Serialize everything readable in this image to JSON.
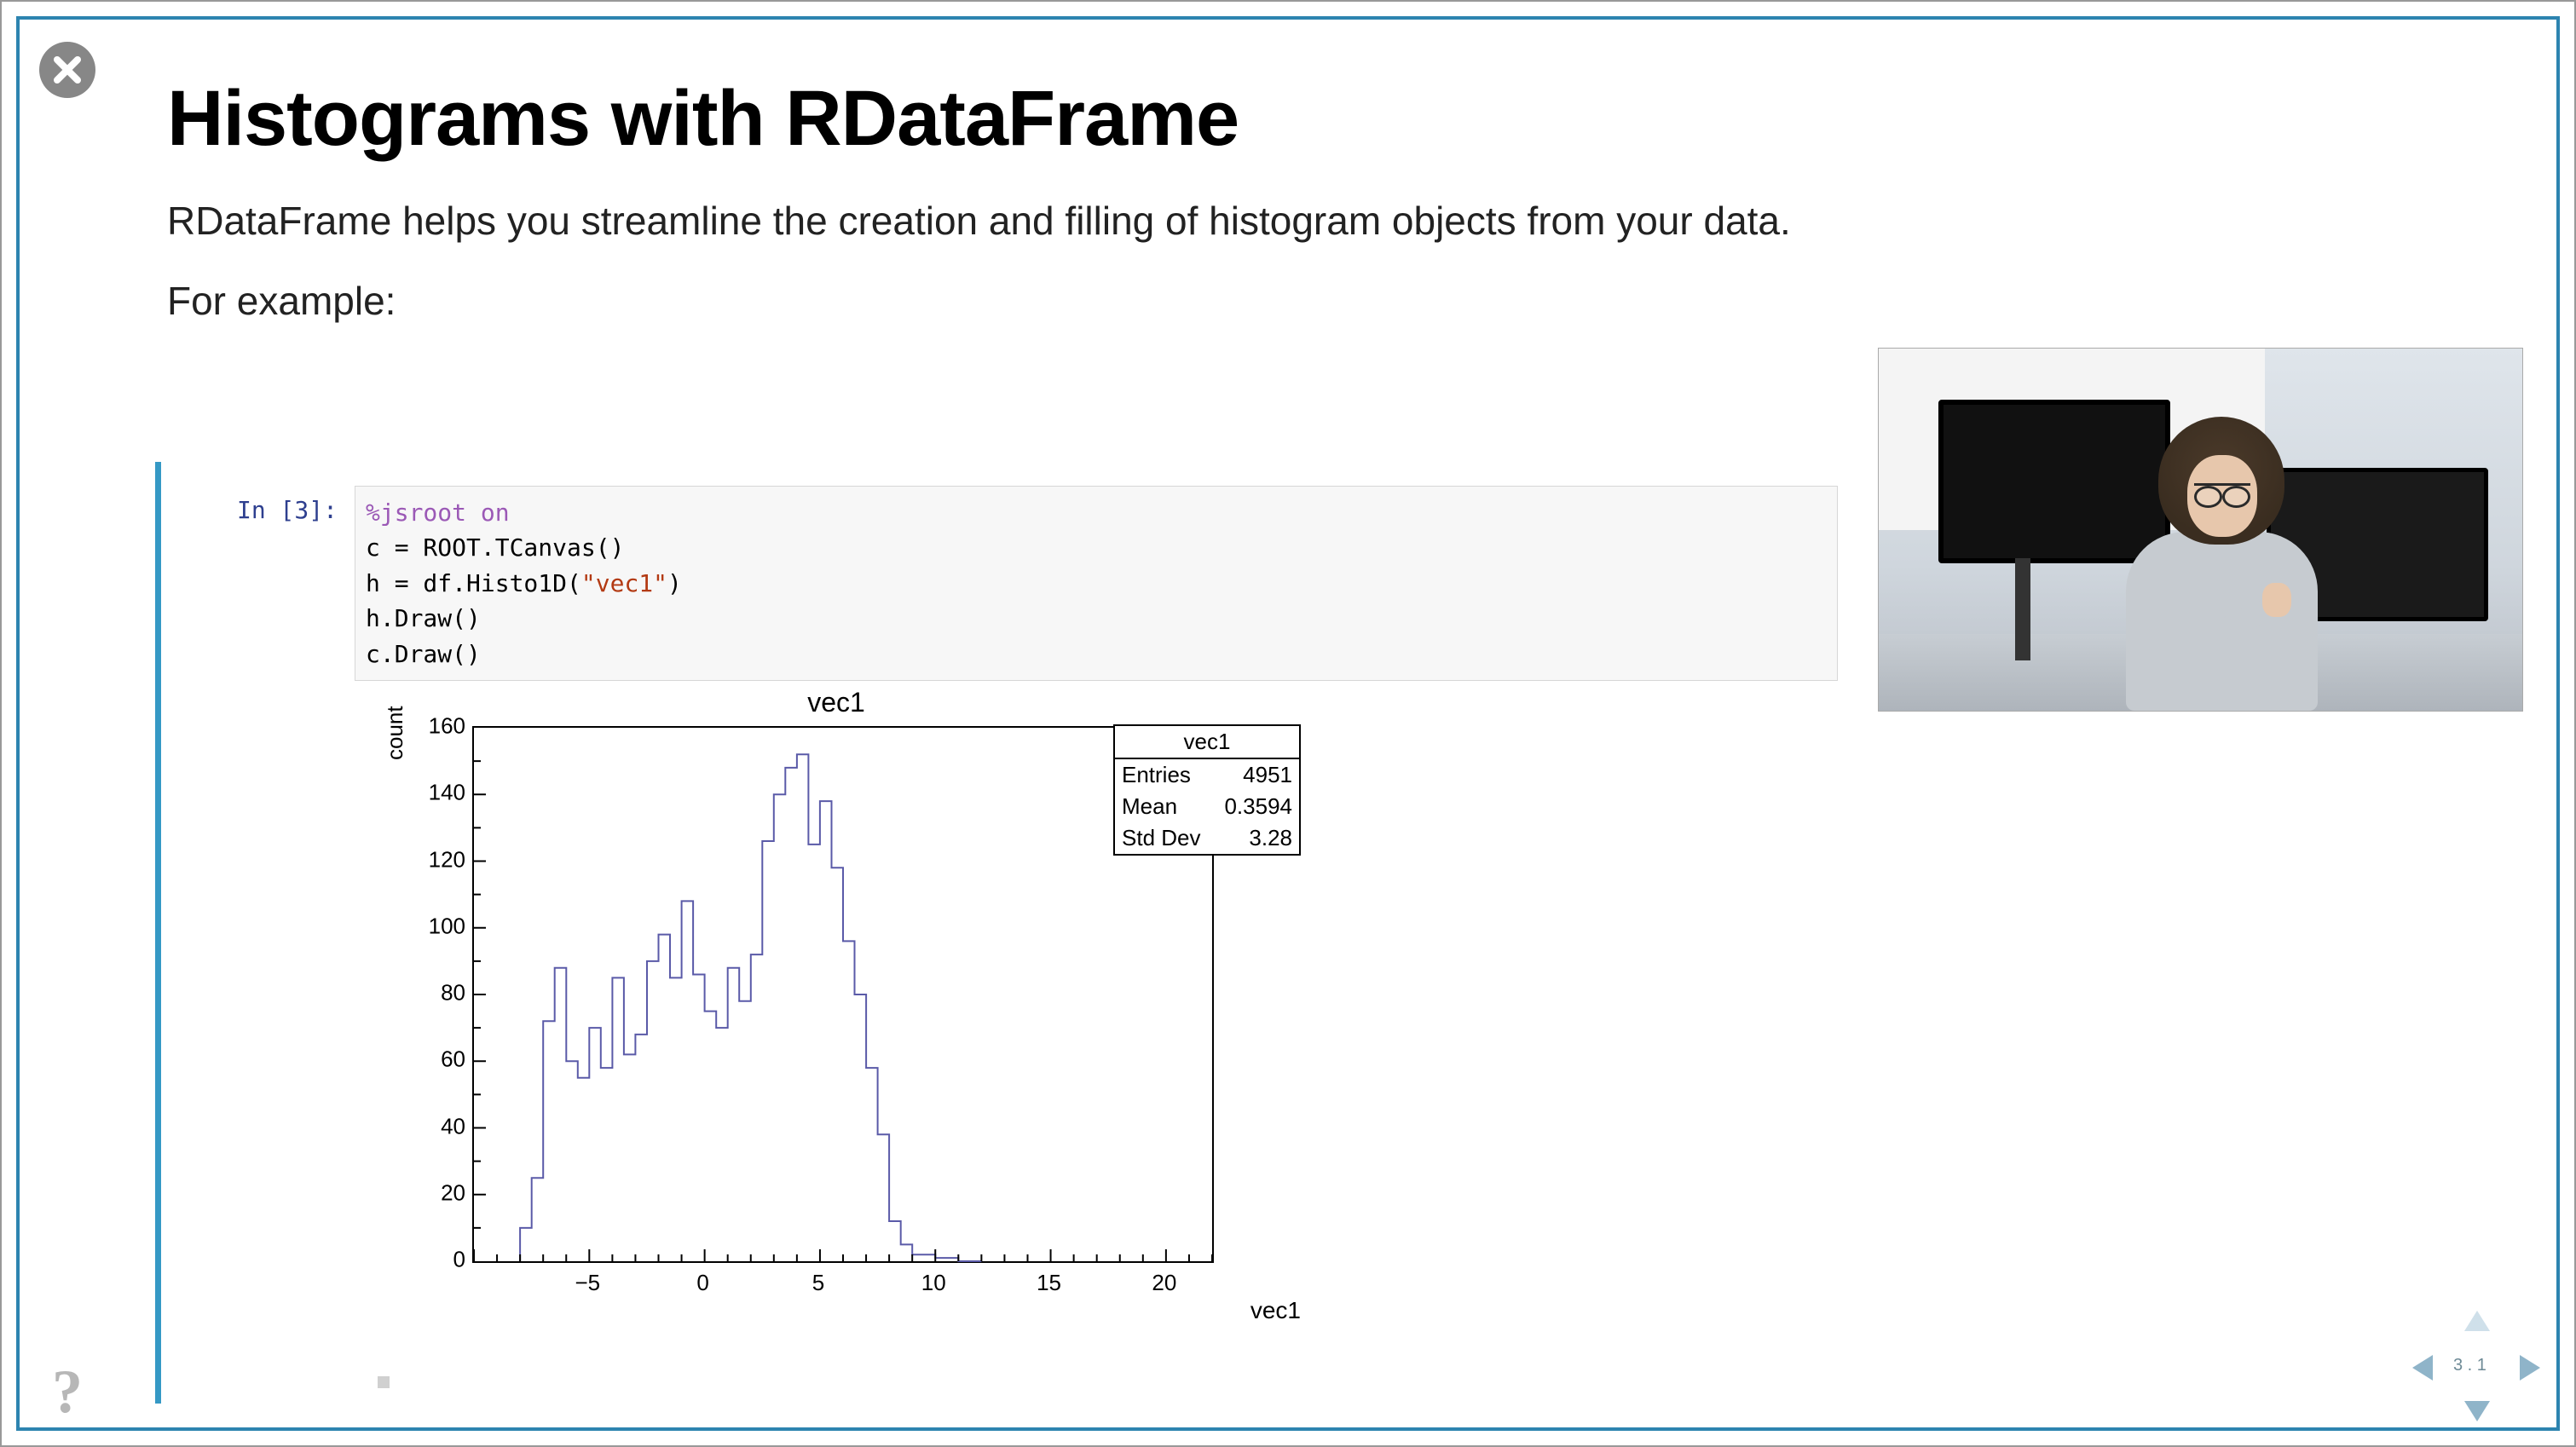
{
  "slide": {
    "title": "Histograms with RDataFrame",
    "subtitle": "RDataFrame helps you streamline the creation and filling of histogram objects from your data.",
    "example_label": "For example:",
    "page_indicator": "3 . 1"
  },
  "controls": {
    "close_label": "Close",
    "help_label": "?",
    "nav_prev": "Previous",
    "nav_next": "Next",
    "nav_up": "Up",
    "nav_down": "Down"
  },
  "notebook": {
    "prompt": "In [3]:",
    "code_lines": {
      "l1_magic": "%jsroot on",
      "l2": "c = ROOT.TCanvas()",
      "l3_pre": "h = df.Histo1D(",
      "l3_str": "\"vec1\"",
      "l3_post": ")",
      "l4": "h.Draw()",
      "l5": "c.Draw()"
    }
  },
  "chart_data": {
    "type": "bar",
    "title": "vec1",
    "xlabel": "vec1",
    "ylabel": "count",
    "xlim": [
      -10,
      22
    ],
    "ylim": [
      0,
      160
    ],
    "x_ticks": [
      -5,
      0,
      5,
      10,
      15,
      20
    ],
    "y_ticks": [
      0,
      20,
      40,
      60,
      80,
      100,
      120,
      140,
      160
    ],
    "stats": {
      "name": "vec1",
      "entries_label": "Entries",
      "entries": 4951,
      "mean_label": "Mean",
      "mean": 0.3594,
      "stddev_label": "Std Dev",
      "stddev": 3.28
    },
    "bin_width": 0.5,
    "bins_start": -8.0,
    "values": [
      10,
      25,
      72,
      88,
      60,
      55,
      70,
      58,
      85,
      62,
      68,
      90,
      98,
      85,
      108,
      86,
      75,
      70,
      88,
      78,
      92,
      126,
      140,
      148,
      152,
      125,
      138,
      118,
      96,
      80,
      58,
      38,
      12,
      5,
      2,
      2,
      1,
      1,
      0,
      0
    ]
  }
}
